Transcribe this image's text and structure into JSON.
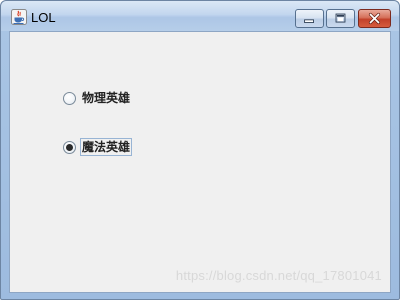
{
  "window": {
    "title": "LOL",
    "icon": "java-cup-icon"
  },
  "controls": {
    "minimize": "minimize-icon",
    "maximize": "maximize-icon",
    "close": "close-icon",
    "close_color": "#c2412a"
  },
  "radios": [
    {
      "label": "物理英雄",
      "checked": false
    },
    {
      "label": "魔法英雄",
      "checked": true
    }
  ],
  "watermark": "https://blog.csdn.net/qq_17801041"
}
